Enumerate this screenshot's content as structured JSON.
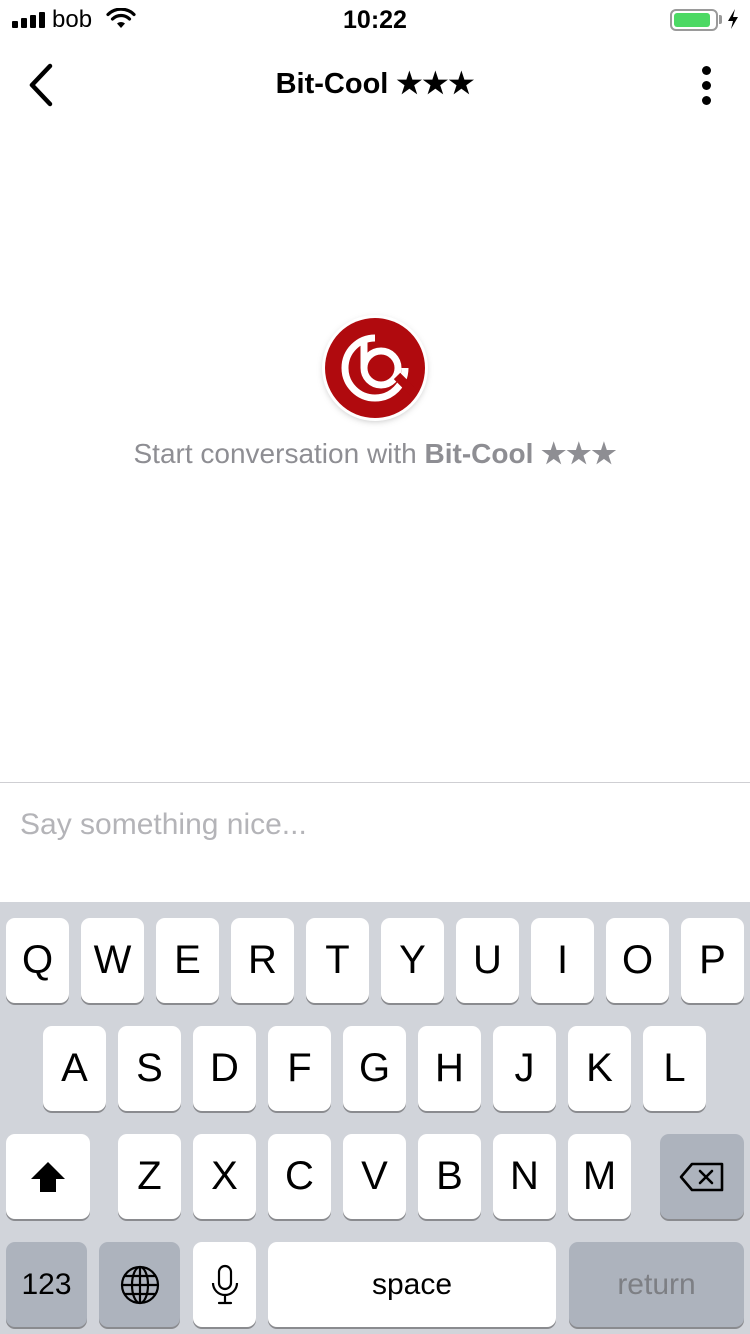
{
  "status_bar": {
    "carrier": "bob",
    "time": "10:22",
    "battery_level": 0.9,
    "battery_color": "#4cd964"
  },
  "nav": {
    "title": "Bit-Cool ★★★",
    "back_icon": "chevron-left-icon",
    "menu_icon": "more-vertical-icon"
  },
  "conversation": {
    "avatar_icon": "bit-cool-logo",
    "brand_color": "#b00a0e",
    "empty_prefix": "Start conversation with",
    "empty_name": "Bit-Cool ★★★"
  },
  "composer": {
    "placeholder": "Say something nice..."
  },
  "keyboard": {
    "row1": [
      "Q",
      "W",
      "E",
      "R",
      "T",
      "Y",
      "U",
      "I",
      "O",
      "P"
    ],
    "row2": [
      "A",
      "S",
      "D",
      "F",
      "G",
      "H",
      "J",
      "K",
      "L"
    ],
    "row3": [
      "Z",
      "X",
      "C",
      "V",
      "B",
      "N",
      "M"
    ],
    "numbers_label": "123",
    "space_label": "space",
    "return_label": "return",
    "shift_icon": "shift-icon",
    "delete_icon": "backspace-icon",
    "globe_icon": "globe-icon",
    "mic_icon": "microphone-icon"
  }
}
